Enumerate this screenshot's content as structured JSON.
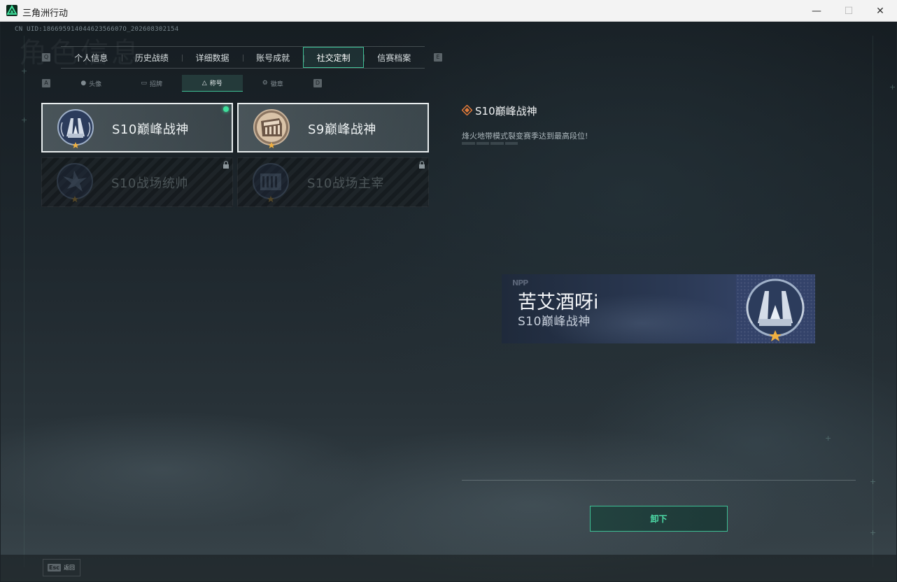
{
  "window": {
    "title": "三角洲行动",
    "minimize_glyph": "—",
    "maximize_glyph": "☐",
    "close_glyph": "✕"
  },
  "header": {
    "uid": "CN UID:18669591404462356607O_202608302154",
    "background_title": "角色信息"
  },
  "key_hints": {
    "prev_tab": "Q",
    "next_tab": "E",
    "prev_subtab": "A",
    "next_subtab": "D"
  },
  "main_tabs": [
    {
      "label": "个人信息"
    },
    {
      "label": "历史战绩"
    },
    {
      "label": "详细数据"
    },
    {
      "label": "账号成就"
    },
    {
      "label": "社交定制",
      "active": true
    },
    {
      "label": "信赛档案"
    }
  ],
  "sub_tabs": [
    {
      "label": "头像",
      "icon": "person-icon"
    },
    {
      "label": "招牌",
      "icon": "sign-icon"
    },
    {
      "label": "称号",
      "icon": "triangle-icon",
      "active": true
    },
    {
      "label": "徽章",
      "icon": "badge-icon"
    }
  ],
  "titles": [
    {
      "name": "S10巅峰战神",
      "locked": false,
      "equipped": true
    },
    {
      "name": "S9巅峰战神",
      "locked": false,
      "equipped": false
    },
    {
      "name": "S10战场统帅",
      "locked": true,
      "equipped": false
    },
    {
      "name": "S10战场主宰",
      "locked": true,
      "equipped": false
    }
  ],
  "detail": {
    "title": "S10巅峰战神",
    "description": "烽火地带模式裂变赛季达到最高段位!"
  },
  "nameplate": {
    "logo": "NPP",
    "player_name": "苦艾酒呀i",
    "title": "S10巅峰战神"
  },
  "actions": {
    "unequip_label": "卸下"
  },
  "footer": {
    "esc_key": "Esc",
    "back_label": "返回"
  },
  "colors": {
    "accent": "#3fbf95",
    "accent_text": "#4ee0aa",
    "equipped_dot": "#3fe09c",
    "diamond": "#e07a3a",
    "star": "#f0b040"
  }
}
